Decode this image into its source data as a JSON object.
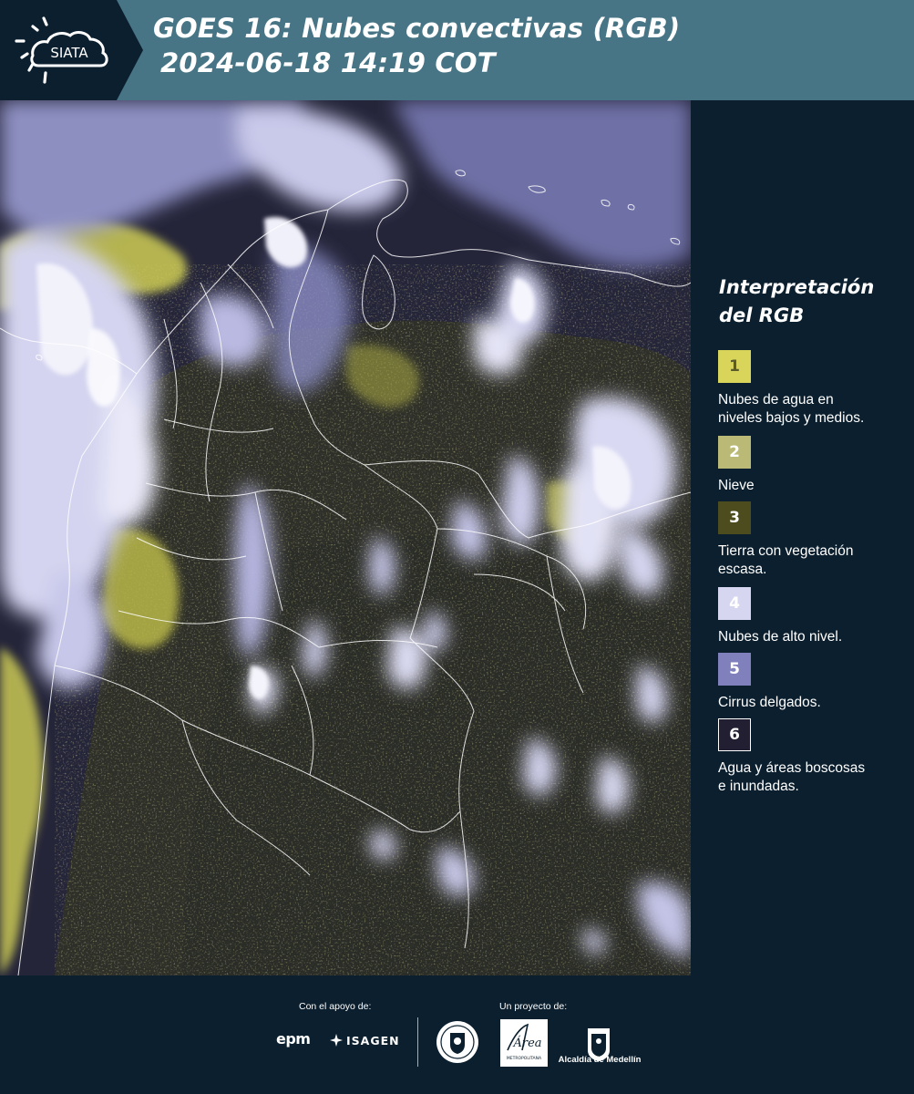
{
  "header": {
    "logo_text": "SIATA",
    "title_line_1": "GOES 16: Nubes convectivas (RGB)",
    "title_line_2": "2024-06-18 14:19 COT",
    "background_color": "#477585",
    "logo_tab_color": "#0b1f2e"
  },
  "legend": {
    "title_line_1": "Interpretación",
    "title_line_2": "del RGB",
    "items": [
      {
        "number": "1",
        "label_lines": [
          "Nubes de agua en",
          "niveles bajos y medios."
        ],
        "swatch_color": "#d8d55a",
        "number_color": "#5a5a2a"
      },
      {
        "number": "2",
        "label_lines": [
          "Nieve"
        ],
        "swatch_color": "#bbb976",
        "number_color": "#ffffff"
      },
      {
        "number": "3",
        "label_lines": [
          "Tierra con vegetación",
          "escasa."
        ],
        "swatch_color": "#4d4c1f",
        "number_color": "#ffffff"
      },
      {
        "number": "4",
        "label_lines": [
          "Nubes de alto nivel."
        ],
        "swatch_color": "#d6d6f0",
        "number_color": "#ffffff"
      },
      {
        "number": "5",
        "label_lines": [
          "Cirrus delgados."
        ],
        "swatch_color": "#8080bd",
        "number_color": "#ffffff"
      },
      {
        "number": "6",
        "label_lines": [
          "Agua y áreas boscosas",
          "e inundadas."
        ],
        "swatch_color": "#221f33",
        "number_color": "#ffffff"
      }
    ]
  },
  "footer": {
    "support_caption": "Con el apoyo de:",
    "project_caption": "Un proyecto de:",
    "epm_logo_text": "epm",
    "isagen_logo_text": "ISAGEN",
    "area_metro_logo_text": "Área",
    "area_metro_subtext": "METROPOLITANA",
    "alcaldia_logo_text": "Alcaldía de Medellín"
  },
  "map": {
    "cloud_high_color": "#d6d6f0",
    "cloud_low_color": "#d8d55a",
    "land_color": "#2a2b28",
    "boundary_color": "#ffffff"
  }
}
